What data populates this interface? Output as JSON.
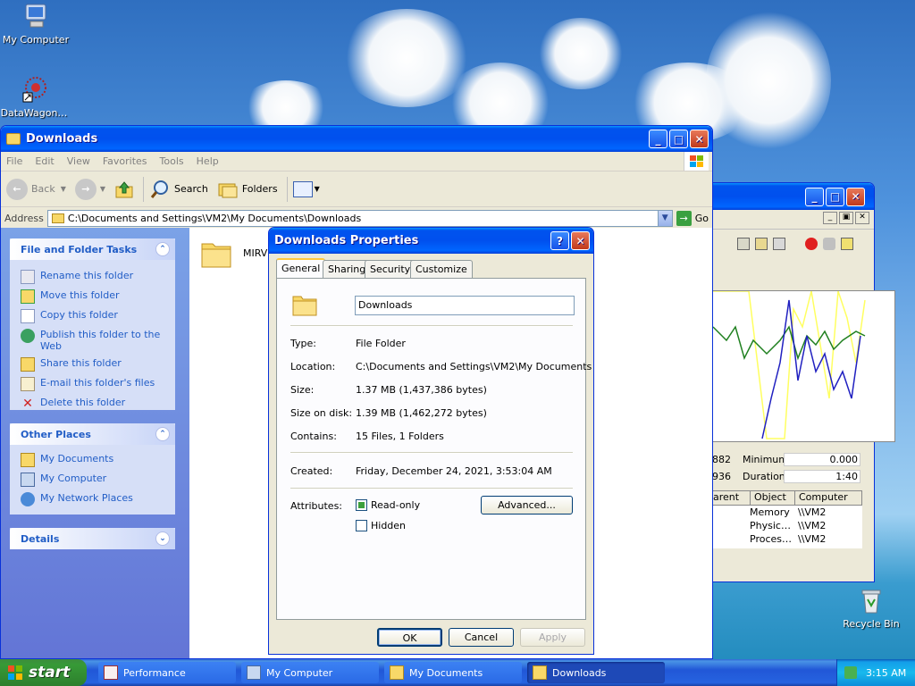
{
  "desktop": {
    "icons": [
      {
        "label": "My Computer",
        "icon": "my-computer-icon"
      },
      {
        "label": "DataWagon…",
        "icon": "datawagon-icon"
      },
      {
        "label": "Recycle Bin",
        "icon": "recycle-bin-icon"
      }
    ]
  },
  "perf_window": {
    "stats": {
      "v1": "882",
      "v1_label": "Minimum",
      "v1_val": "0.000",
      "v2": "936",
      "v2_label": "Duration",
      "v2_val": "1:40"
    },
    "columns": [
      "arent",
      "Object",
      "Computer"
    ],
    "rows": [
      {
        "object": "Memory",
        "computer": "\\\\VM2"
      },
      {
        "object": "Physic…",
        "computer": "\\\\VM2"
      },
      {
        "object": "Proces…",
        "computer": "\\\\VM2"
      }
    ]
  },
  "explorer": {
    "title": "Downloads",
    "menu": [
      "File",
      "Edit",
      "View",
      "Favorites",
      "Tools",
      "Help"
    ],
    "toolbar": {
      "back": "Back",
      "search": "Search",
      "folders": "Folders"
    },
    "address_label": "Address",
    "address": "C:\\Documents and Settings\\VM2\\My Documents\\Downloads",
    "go": "Go",
    "file_tasks": {
      "title": "File and Folder Tasks",
      "items": [
        "Rename this folder",
        "Move this folder",
        "Copy this folder",
        "Publish this folder to the Web",
        "Share this folder",
        "E-mail this folder's files",
        "Delete this folder"
      ]
    },
    "other_places": {
      "title": "Other Places",
      "items": [
        "My Documents",
        "My Computer",
        "My Network Places"
      ]
    },
    "details": {
      "title": "Details"
    },
    "files": [
      {
        "name": "MIRV"
      }
    ]
  },
  "dialog": {
    "title": "Downloads Properties",
    "tabs": [
      "General",
      "Sharing",
      "Security",
      "Customize"
    ],
    "name": "Downloads",
    "props": [
      {
        "label": "Type:",
        "value": "File Folder"
      },
      {
        "label": "Location:",
        "value": "C:\\Documents and Settings\\VM2\\My Documents"
      },
      {
        "label": "Size:",
        "value": "1.37 MB (1,437,386 bytes)"
      },
      {
        "label": "Size on disk:",
        "value": "1.39 MB (1,462,272 bytes)"
      },
      {
        "label": "Contains:",
        "value": "15 Files, 1 Folders"
      }
    ],
    "created_label": "Created:",
    "created": "Friday, December 24, 2021, 3:53:04 AM",
    "attributes_label": "Attributes:",
    "readonly": "Read-only",
    "hidden": "Hidden",
    "advanced": "Advanced...",
    "ok": "OK",
    "cancel": "Cancel",
    "apply": "Apply"
  },
  "taskbar": {
    "start": "start",
    "tasks": [
      "Performance",
      "My Computer",
      "My Documents",
      "Downloads"
    ],
    "clock": "3:15 AM"
  }
}
